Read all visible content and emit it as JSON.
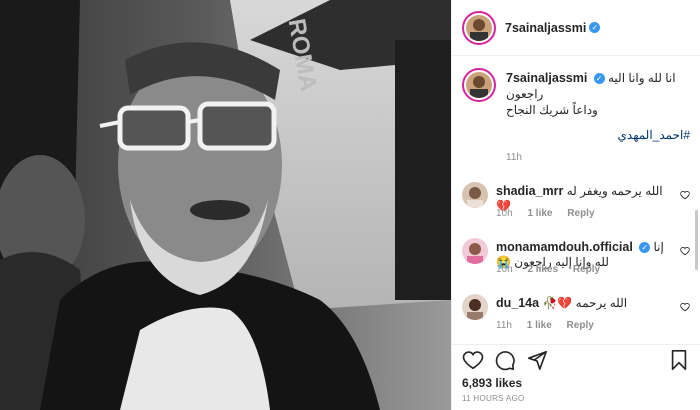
{
  "post": {
    "username": "7sainaljassmi",
    "verified_mark": "✓",
    "caption_line1": "انا لله وانا اليه راجعون",
    "caption_line2": "وداعاً شريك النجاح",
    "hashtag": "#احمد_المهدي",
    "caption_time": "11h",
    "likes": "6,893 likes",
    "posted_ago": "11 HOURS AGO",
    "photo_text": "ROMA"
  },
  "comments": [
    {
      "username": "shadia_mrr",
      "verified": false,
      "text": "الله يرحمه ويغفر له 💔",
      "time": "10h",
      "likes": "1 like",
      "reply": "Reply"
    },
    {
      "username": "monamamdouh.official",
      "verified": true,
      "text": "إنا لله وإنا إليه راجعون 😭",
      "time": "10h",
      "likes": "2 likes",
      "reply": "Reply"
    },
    {
      "username": "du_14a",
      "verified": false,
      "text": "الله يرحمه 💔🥀",
      "time": "11h",
      "likes": "1 like",
      "reply": "Reply"
    }
  ],
  "icons": {
    "like": "heart-icon",
    "comment": "comment-icon",
    "share": "share-icon",
    "save": "bookmark-icon"
  },
  "colors": {
    "link": "#00376b",
    "verified": "#3897f0",
    "story_ring": "#d6249f",
    "meta": "#8e8e8e"
  }
}
